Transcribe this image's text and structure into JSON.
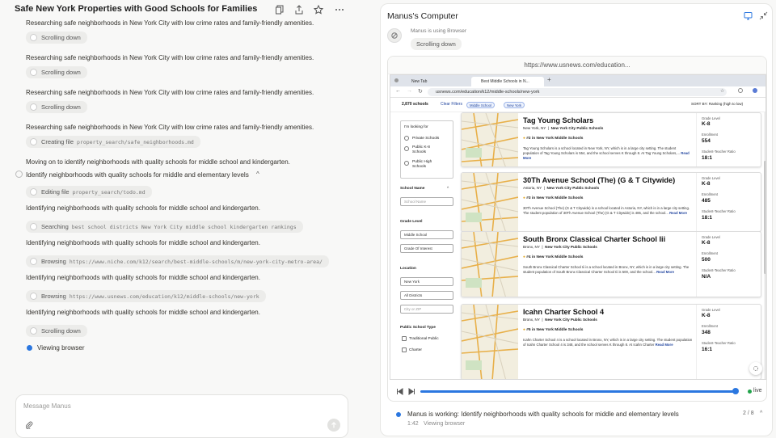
{
  "chat": {
    "title": "Safe New York Properties with Good Schools for Families",
    "items": [
      {
        "kind": "text",
        "text": "Researching safe neighborhoods in New York City with low crime rates and family-friendly amenities."
      },
      {
        "kind": "chip",
        "label": "Scrolling down",
        "arg": ""
      },
      {
        "kind": "text",
        "text": "Researching safe neighborhoods in New York City with low crime rates and family-friendly amenities."
      },
      {
        "kind": "chip",
        "label": "Scrolling down",
        "arg": ""
      },
      {
        "kind": "text",
        "text": "Researching safe neighborhoods in New York City with low crime rates and family-friendly amenities."
      },
      {
        "kind": "chip",
        "label": "Scrolling down",
        "arg": ""
      },
      {
        "kind": "text",
        "text": "Researching safe neighborhoods in New York City with low crime rates and family-friendly amenities."
      },
      {
        "kind": "chip",
        "label": "Creating file",
        "arg": "property_search/safe_neighborhoods.md"
      },
      {
        "kind": "text",
        "text": "Moving on to identify neighborhoods with quality schools for middle school and kindergarten."
      },
      {
        "kind": "step",
        "text": "Identify neighborhoods with quality schools for middle and elementary levels"
      },
      {
        "kind": "chip",
        "label": "Editing file",
        "arg": "property_search/todo.md"
      },
      {
        "kind": "text",
        "text": "Identifying neighborhoods with quality schools for middle school and kindergarten."
      },
      {
        "kind": "chip",
        "label": "Searching",
        "arg": "best school districts New York City middle school kindergarten rankings"
      },
      {
        "kind": "text",
        "text": "Identifying neighborhoods with quality schools for middle school and kindergarten."
      },
      {
        "kind": "chip",
        "label": "Browsing",
        "arg": "https://www.niche.com/k12/search/best-middle-schools/m/new-york-city-metro-area/"
      },
      {
        "kind": "text",
        "text": "Identifying neighborhoods with quality schools for middle school and kindergarten."
      },
      {
        "kind": "chip",
        "label": "Browsing",
        "arg": "https://www.usnews.com/education/k12/middle-schools/new-york"
      },
      {
        "kind": "text",
        "text": "Identifying neighborhoods with quality schools for middle school and kindergarten."
      },
      {
        "kind": "chip",
        "label": "Scrolling down",
        "arg": ""
      },
      {
        "kind": "viewing",
        "text": "Viewing browser"
      }
    ],
    "composer_placeholder": "Message Manus"
  },
  "computer": {
    "title": "Manus's Computer",
    "using": "Manus is using Browser",
    "action": "Scrolling down",
    "url": "https://www.usnews.com/education...",
    "tabs": [
      "New Tab",
      "Best Middle Schools in N..."
    ],
    "address": "usnews.com/education/k12/middle-schools/new-york",
    "schools_count": "2,870 schools",
    "clear_filters": "Clear Filters",
    "pills": [
      "Middle School",
      "New York"
    ],
    "sort": "SORT BY:  Ranking (high to low)",
    "sidebar": {
      "looking_for": "I'm looking for",
      "options": [
        "Private Schools",
        "Public K-8 Schools",
        "Public High Schools"
      ],
      "school_name": "School Name",
      "school_name_ph": "School Name",
      "grade_level": "Grade Level",
      "grade_value": "Middle School",
      "grade_interest": "Grade Of Interest",
      "location": "Location",
      "state": "New York",
      "district": "All Districts",
      "city_ph": "City or ZIP",
      "public_type": "Public School Type",
      "types": [
        "Traditional Public",
        "Charter"
      ]
    },
    "schools": [
      {
        "name": "Tag Young Scholars",
        "loc": "New York, NY",
        "dist": "New York City Public Schools",
        "rank": "#2 in New York Middle Schools",
        "desc": "Tag Young Scholars is a school located in New York, NY, which is in a large city setting. The student population of Tag Young Scholars is 554, and the school serves K through 8. At Tag Young Scholars,...",
        "grade": "K-8",
        "enroll": "554",
        "ratio": "18:1"
      },
      {
        "name": "30Th Avenue School (The) (G & T Citywide)",
        "loc": "Astoria, NY",
        "dist": "New York City Public Schools",
        "rank": "#3 in New York Middle Schools",
        "desc": "30Th Avenue School (The) (G & T Citywide) is a school located in Astoria, NY, which is in a large city setting. The student population of 30Th Avenue School (The) (G & T Citywide) is 485, and the school...",
        "grade": "K-8",
        "enroll": "485",
        "ratio": "18:1"
      },
      {
        "name": "South Bronx Classical Charter School Iii",
        "loc": "Bronx, NY",
        "dist": "New York City Public Schools",
        "rank": "#4 in New York Middle Schools",
        "desc": "South Bronx Classical Charter School Iii is a school located in Bronx, NY, which is in a large city setting. The student population of South Bronx Classical Charter School Iii is 500, and the school...",
        "grade": "K-8",
        "enroll": "500",
        "ratio": "N/A"
      },
      {
        "name": "Icahn Charter School 4",
        "loc": "Bronx, NY",
        "dist": "New York City Public Schools",
        "rank": "#5 in New York Middle Schools",
        "desc": "Icahn Charter School 4 is a school located in Bronx, NY, which is in a large city setting. The student population of Icahn Charter School 4 is 348, and the school serves K through 8. At Icahn Charter",
        "grade": "K-8",
        "enroll": "348",
        "ratio": "16:1"
      }
    ],
    "read_more": "Read More",
    "labels": {
      "grade": "Grade Level",
      "enroll": "Enrollment",
      "ratio": "Student-Teacher Ratio"
    },
    "live": "live",
    "status_text": "Manus is working: Identify neighborhoods with quality schools for middle and elementary levels",
    "status_time": "1:42",
    "status_sub": "Viewing browser",
    "status_count": "2 / 8"
  },
  "progress": {
    "played_fraction": 0.98
  },
  "colors": {
    "accent": "#2b77e0",
    "live": "#22a34a"
  }
}
